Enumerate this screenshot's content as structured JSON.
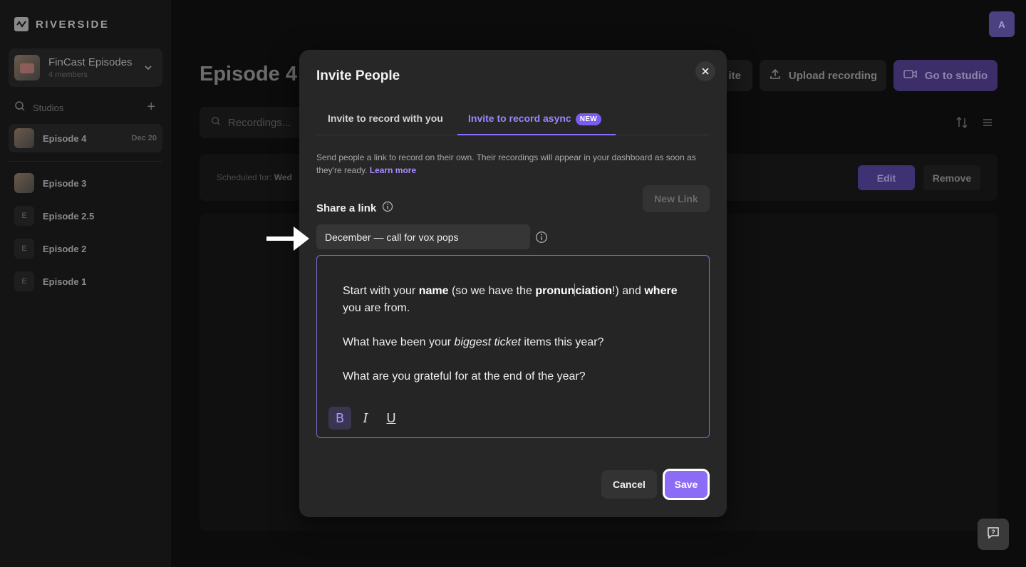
{
  "app": {
    "brand": "RIVERSIDE"
  },
  "sidebar": {
    "workspace": {
      "title": "FinCast Episodes",
      "subtitle": "4 members"
    },
    "studios_label": "Studios",
    "items": [
      {
        "name": "Episode 4",
        "date": "Dec 20"
      },
      {
        "name": "Episode 3"
      },
      {
        "letter": "E",
        "name": "Episode 2.5"
      },
      {
        "letter": "E",
        "name": "Episode 2"
      },
      {
        "letter": "E",
        "name": "Episode 1"
      }
    ]
  },
  "header": {
    "title": "Episode 4",
    "invite_partial": "ite",
    "upload": "Upload recording",
    "go_to_studio": "Go to studio",
    "avatar_letter": "A"
  },
  "main": {
    "search_placeholder": "Recordings...",
    "scheduled_label": "Scheduled for:",
    "scheduled_value": "Wed",
    "edit": "Edit",
    "remove": "Remove"
  },
  "modal": {
    "title": "Invite People",
    "tabs": [
      {
        "label": "Invite to record with you"
      },
      {
        "label": "Invite to record async",
        "badge": "NEW"
      }
    ],
    "description": "Send people a link to record on their own. Their recordings will appear in your dashboard as soon as they're ready.",
    "learn_more": "Learn more",
    "new_link": "New Link",
    "share_label": "Share a link",
    "link_name": "December — call for vox pops",
    "editor": {
      "p1_a": "Start with your ",
      "p1_b": "name",
      "p1_c": " (so we have the ",
      "p1_d1": "pronun",
      "p1_d2": "ciation",
      "p1_e": "!) and ",
      "p1_f": "where",
      "p1_g": " you are from.",
      "p2_a": "What have been your ",
      "p2_b": "biggest ticket",
      "p2_c": " items this year?",
      "p3": "What are you grateful for at the end of the year?",
      "format_buttons": [
        "B",
        "I",
        "U"
      ]
    },
    "cancel": "Cancel",
    "save": "Save"
  },
  "colors": {
    "accent": "#8b6cf6",
    "accent_text": "#9e84ff",
    "modal_bg": "#272727",
    "page_bg": "#0c0c0c"
  }
}
